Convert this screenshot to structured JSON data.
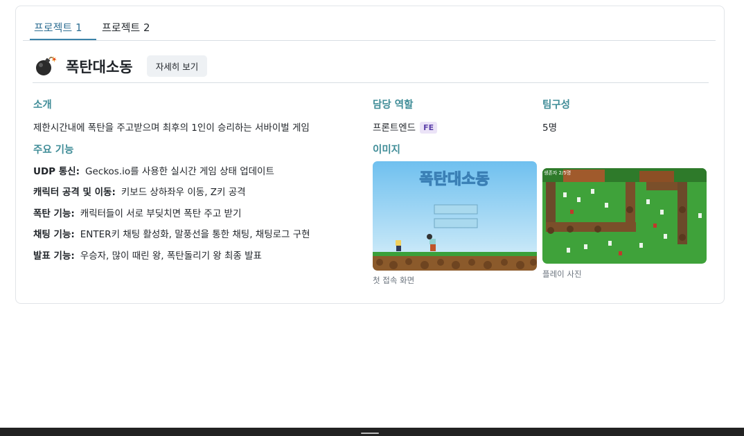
{
  "tabs": [
    {
      "label": "프로젝트 1",
      "active": true
    },
    {
      "label": "프로젝트 2",
      "active": false
    }
  ],
  "project": {
    "icon": "bomb-icon",
    "title": "폭탄대소동",
    "detail_button": "자세히 보기"
  },
  "intro": {
    "heading": "소개",
    "text": "제한시간내에 폭탄을 주고받으며 최후의 1인이 승리하는 서바이벌 게임"
  },
  "role": {
    "heading": "담당 역할",
    "text": "프론트엔드",
    "badge": "FE"
  },
  "team": {
    "heading": "팀구성",
    "text": "5명"
  },
  "features": {
    "heading": "주요 기능",
    "items": [
      {
        "name": "UDP 통신:",
        "desc": "Geckos.io를 사용한 실시간 게임 상태 업데이트"
      },
      {
        "name": "캐릭터 공격 및 이동:",
        "desc": "키보드 상하좌우 이동, Z키 공격"
      },
      {
        "name": "폭탄 기능:",
        "desc": "캐릭터들이 서로 부딪치면 폭탄 주고 받기"
      },
      {
        "name": "채팅 기능:",
        "desc": "ENTER키 채팅 활성화, 말풍선을 통한 채팅, 채팅로그 구현"
      },
      {
        "name": "발표 기능:",
        "desc": "우승자, 많이 때린 왕, 폭탄돌리기 왕 최종 발표"
      }
    ]
  },
  "images": {
    "heading": "이미지",
    "items": [
      {
        "caption": "첫 접속 화면",
        "game_title": "폭탄대소동"
      },
      {
        "caption": "플레이 사진",
        "overlay": "생존자 2/5명"
      }
    ]
  },
  "colors": {
    "accent": "#3f8c97",
    "tab_active": "#2f6f93",
    "badge_bg": "#ebe3f7",
    "badge_fg": "#5a3fa8"
  }
}
